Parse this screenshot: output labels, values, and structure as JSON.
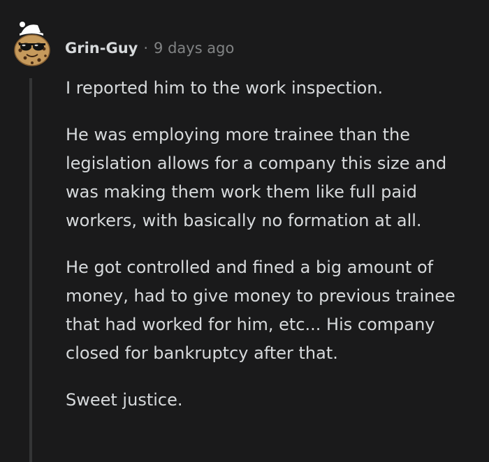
{
  "comment": {
    "author": "Grin-Guy",
    "separator": "·",
    "timestamp": "9 days ago",
    "avatar_icon": "snoo-cookie-sunglasses-santa-hat-icon",
    "paragraphs": [
      "I reported him to the work inspection.",
      "He was employing more trainee than the legislation allows for a company this size and was making them work them like full paid workers, with basically no formation at all.",
      "He got controlled and fined a big amount of money, had to give money to previous trainee that had worked for him, etc... His company closed for bankruptcy after that.",
      "Sweet justice."
    ]
  },
  "colors": {
    "background": "#1a1a1b",
    "text": "#d7dadc",
    "meta": "#818384",
    "thread_line": "#343536"
  }
}
